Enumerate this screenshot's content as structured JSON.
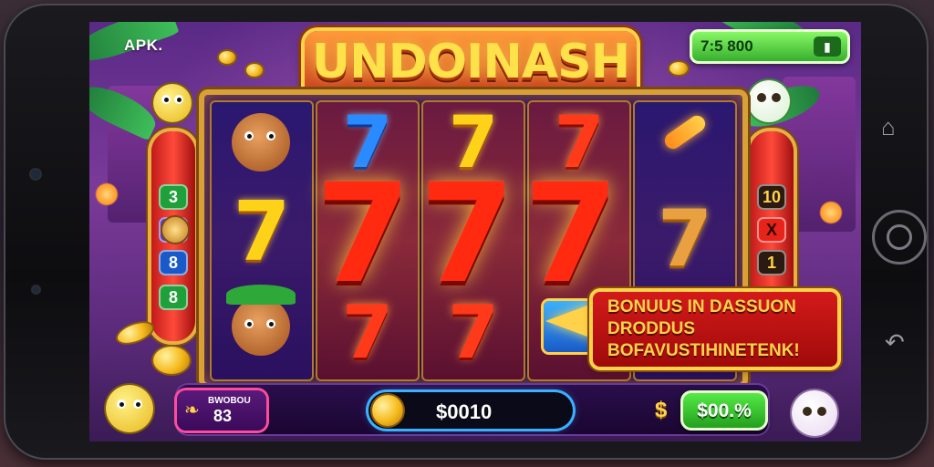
{
  "app": {
    "badge": "APK."
  },
  "game": {
    "title": "UNDOINASH"
  },
  "wallet": {
    "balance": "7:5 800"
  },
  "left_column": {
    "chips": [
      "3",
      "8",
      "8",
      "8"
    ]
  },
  "right_column": {
    "chips": [
      "10",
      "X",
      "1"
    ]
  },
  "bonus_banner": {
    "line1": "BONUUS IN DASSUON",
    "line2": "DRODDUS",
    "line3": "BOFAVUSTIHINETENK!"
  },
  "hud": {
    "bet_label": "BWOBOU",
    "bet_value": "83",
    "credit_value": "$0010",
    "currency_symbol": "$",
    "win_value": "$00.%"
  },
  "icons": {
    "home": "home-icon",
    "circle": "home-button-icon",
    "back": "back-icon"
  },
  "colors": {
    "frame_gold": "#d9a035",
    "seven_red": "#ff2a10",
    "wallet_green": "#2fa82a",
    "banner_red": "#d41a1a"
  }
}
